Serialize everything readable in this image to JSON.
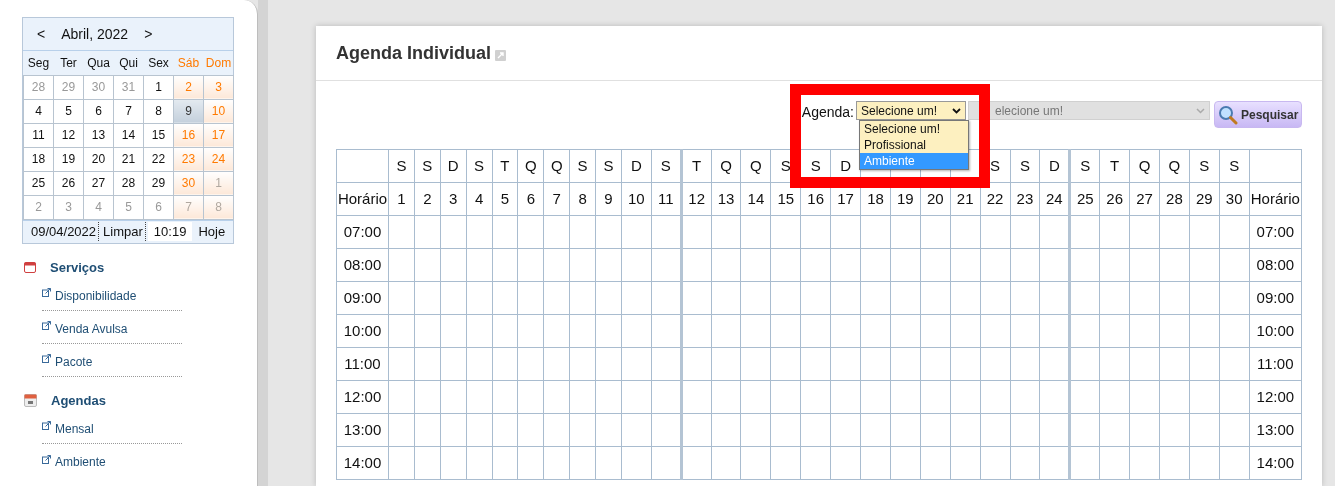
{
  "calendar": {
    "prev": "<",
    "title": "Abril, 2022",
    "next": ">",
    "weekdays": [
      {
        "label": "Seg",
        "weekend": false
      },
      {
        "label": "Ter",
        "weekend": false
      },
      {
        "label": "Qua",
        "weekend": false
      },
      {
        "label": "Qui",
        "weekend": false
      },
      {
        "label": "Sex",
        "weekend": false
      },
      {
        "label": "Sáb",
        "weekend": true
      },
      {
        "label": "Dom",
        "weekend": true
      }
    ],
    "weeks": [
      [
        {
          "day": "28",
          "other_month": true,
          "selected": false
        },
        {
          "day": "29",
          "other_month": true,
          "selected": false
        },
        {
          "day": "30",
          "other_month": true,
          "selected": false
        },
        {
          "day": "31",
          "other_month": true,
          "selected": false
        },
        {
          "day": "1",
          "other_month": false,
          "selected": false
        },
        {
          "day": "2",
          "other_month": false,
          "selected": false
        },
        {
          "day": "3",
          "other_month": false,
          "selected": false
        }
      ],
      [
        {
          "day": "4",
          "other_month": false,
          "selected": false
        },
        {
          "day": "5",
          "other_month": false,
          "selected": false
        },
        {
          "day": "6",
          "other_month": false,
          "selected": false
        },
        {
          "day": "7",
          "other_month": false,
          "selected": false
        },
        {
          "day": "8",
          "other_month": false,
          "selected": false
        },
        {
          "day": "9",
          "other_month": false,
          "selected": true
        },
        {
          "day": "10",
          "other_month": false,
          "selected": false
        }
      ],
      [
        {
          "day": "11",
          "other_month": false,
          "selected": false
        },
        {
          "day": "12",
          "other_month": false,
          "selected": false
        },
        {
          "day": "13",
          "other_month": false,
          "selected": false
        },
        {
          "day": "14",
          "other_month": false,
          "selected": false
        },
        {
          "day": "15",
          "other_month": false,
          "selected": false
        },
        {
          "day": "16",
          "other_month": false,
          "selected": false
        },
        {
          "day": "17",
          "other_month": false,
          "selected": false
        }
      ],
      [
        {
          "day": "18",
          "other_month": false,
          "selected": false
        },
        {
          "day": "19",
          "other_month": false,
          "selected": false
        },
        {
          "day": "20",
          "other_month": false,
          "selected": false
        },
        {
          "day": "21",
          "other_month": false,
          "selected": false
        },
        {
          "day": "22",
          "other_month": false,
          "selected": false
        },
        {
          "day": "23",
          "other_month": false,
          "selected": false
        },
        {
          "day": "24",
          "other_month": false,
          "selected": false
        }
      ],
      [
        {
          "day": "25",
          "other_month": false,
          "selected": false
        },
        {
          "day": "26",
          "other_month": false,
          "selected": false
        },
        {
          "day": "27",
          "other_month": false,
          "selected": false
        },
        {
          "day": "28",
          "other_month": false,
          "selected": false
        },
        {
          "day": "29",
          "other_month": false,
          "selected": false
        },
        {
          "day": "30",
          "other_month": false,
          "selected": false
        },
        {
          "day": "1",
          "other_month": true,
          "selected": false
        }
      ],
      [
        {
          "day": "2",
          "other_month": true,
          "selected": false
        },
        {
          "day": "3",
          "other_month": true,
          "selected": false
        },
        {
          "day": "4",
          "other_month": true,
          "selected": false
        },
        {
          "day": "5",
          "other_month": true,
          "selected": false
        },
        {
          "day": "6",
          "other_month": true,
          "selected": false
        },
        {
          "day": "7",
          "other_month": true,
          "selected": false
        },
        {
          "day": "8",
          "other_month": true,
          "selected": false
        }
      ]
    ],
    "footer": {
      "date": "09/04/2022",
      "clear": "Limpar",
      "time": "10:19",
      "today": "Hoje"
    }
  },
  "sidebar": {
    "sections": [
      {
        "title": "Serviços",
        "kind": "services",
        "items": [
          "Disponibilidade",
          "Venda Avulsa",
          "Pacote"
        ]
      },
      {
        "title": "Agendas",
        "kind": "calendar",
        "items": [
          "Mensal",
          "Ambiente"
        ]
      }
    ]
  },
  "panel": {
    "title": "Agenda Individual",
    "filter": {
      "label": "Agenda:",
      "select_value": "Selecione um!",
      "options": [
        {
          "label": "Selecione um!",
          "selected": false
        },
        {
          "label": "Profissional",
          "selected": false
        },
        {
          "label": "Ambiente",
          "selected": true
        }
      ],
      "second_select": {
        "placeholder": "elecione um!",
        "disabled": true
      },
      "search_button": "Pesquisar"
    },
    "table": {
      "time_header_left": "Horário",
      "time_header_right": "Horário",
      "days": [
        {
          "letter": "S",
          "day": "1",
          "divider_after": false
        },
        {
          "letter": "S",
          "day": "2",
          "divider_after": false
        },
        {
          "letter": "D",
          "day": "3",
          "divider_after": false
        },
        {
          "letter": "S",
          "day": "4",
          "divider_after": false
        },
        {
          "letter": "T",
          "day": "5",
          "divider_after": false
        },
        {
          "letter": "Q",
          "day": "6",
          "divider_after": false
        },
        {
          "letter": "Q",
          "day": "7",
          "divider_after": false
        },
        {
          "letter": "S",
          "day": "8",
          "divider_after": false
        },
        {
          "letter": "S",
          "day": "9",
          "divider_after": false
        },
        {
          "letter": "D",
          "day": "10",
          "divider_after": false
        },
        {
          "letter": "S",
          "day": "11",
          "divider_after": true
        },
        {
          "letter": "T",
          "day": "12",
          "divider_after": false
        },
        {
          "letter": "Q",
          "day": "13",
          "divider_after": false
        },
        {
          "letter": "Q",
          "day": "14",
          "divider_after": false
        },
        {
          "letter": "S",
          "day": "15",
          "divider_after": false
        },
        {
          "letter": "S",
          "day": "16",
          "divider_after": false
        },
        {
          "letter": "D",
          "day": "17",
          "divider_after": false
        },
        {
          "day": "18",
          "divider_after": false
        },
        {
          "day": "19",
          "divider_after": false
        },
        {
          "day": "20",
          "divider_after": false
        },
        {
          "day": "21",
          "divider_after": false
        },
        {
          "letter": "S",
          "day": "22",
          "divider_after": false
        },
        {
          "letter": "S",
          "day": "23",
          "divider_after": false
        },
        {
          "letter": "D",
          "day": "24",
          "divider_after": true
        },
        {
          "letter": "S",
          "day": "25",
          "divider_after": false
        },
        {
          "letter": "T",
          "day": "26",
          "divider_after": false
        },
        {
          "letter": "Q",
          "day": "27",
          "divider_after": false
        },
        {
          "letter": "Q",
          "day": "28",
          "divider_after": false
        },
        {
          "letter": "S",
          "day": "29",
          "divider_after": false
        },
        {
          "letter": "S",
          "day": "30",
          "divider_after": false
        }
      ],
      "times": [
        {
          "left": "07:00",
          "right": "07:00"
        },
        {
          "left": "08:00",
          "right": "08:00"
        },
        {
          "left": "09:00",
          "right": "09:00"
        },
        {
          "left": "10:00",
          "right": "10:00"
        },
        {
          "left": "11:00",
          "right": "11:00"
        },
        {
          "left": "12:00",
          "right": "12:00"
        },
        {
          "left": "13:00",
          "right": "13:00"
        },
        {
          "left": "14:00",
          "right": "14:00"
        }
      ]
    }
  }
}
